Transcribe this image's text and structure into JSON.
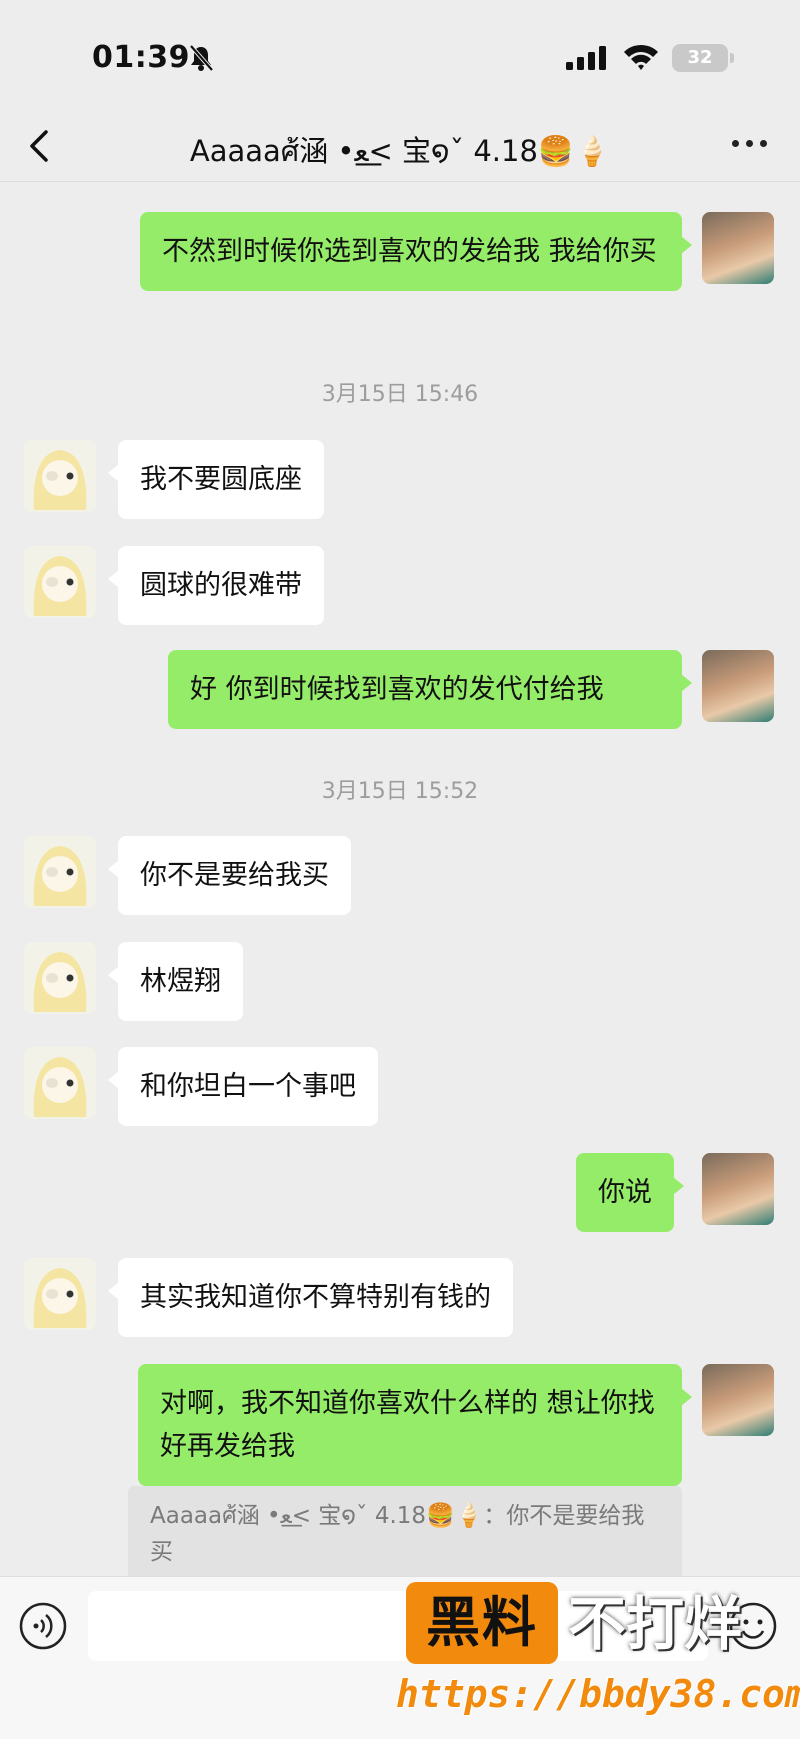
{
  "status_bar": {
    "time": "01:39",
    "battery": "32"
  },
  "nav": {
    "title": "Aaaaaศ้涵 •ﻌ⁠<͟ 宝໑ˇ 4.18🍔🍦"
  },
  "messages": [
    {
      "side": "right",
      "text": "不然到时候你选到喜欢的发给我 我给你买"
    },
    {
      "side": "left",
      "text": "我不要圆底座"
    },
    {
      "side": "left",
      "text": "圆球的很难带"
    },
    {
      "side": "right",
      "text": "好 你到时候找到喜欢的发代付给我"
    },
    {
      "side": "left",
      "text": "你不是要给我买"
    },
    {
      "side": "left",
      "text": "林煜翔"
    },
    {
      "side": "left",
      "text": "和你坦白一个事吧"
    },
    {
      "side": "right",
      "text": "你说"
    },
    {
      "side": "left",
      "text": "其实我知道你不算特别有钱的"
    },
    {
      "side": "right",
      "text": "对啊，我不知道你喜欢什么样的 想让你找好再发给我"
    }
  ],
  "timestamps": [
    "3月15日 15:46",
    "3月15日 15:52"
  ],
  "quote": {
    "text": "Aaaaaศ้涵 •ﻌ⁠<͟ 宝໑ˇ 4.18🍔🍦：你不是要给我买"
  },
  "watermark": {
    "brand": "黑料",
    "tagline": "不打烊",
    "url": "https://bbdy38.com"
  }
}
